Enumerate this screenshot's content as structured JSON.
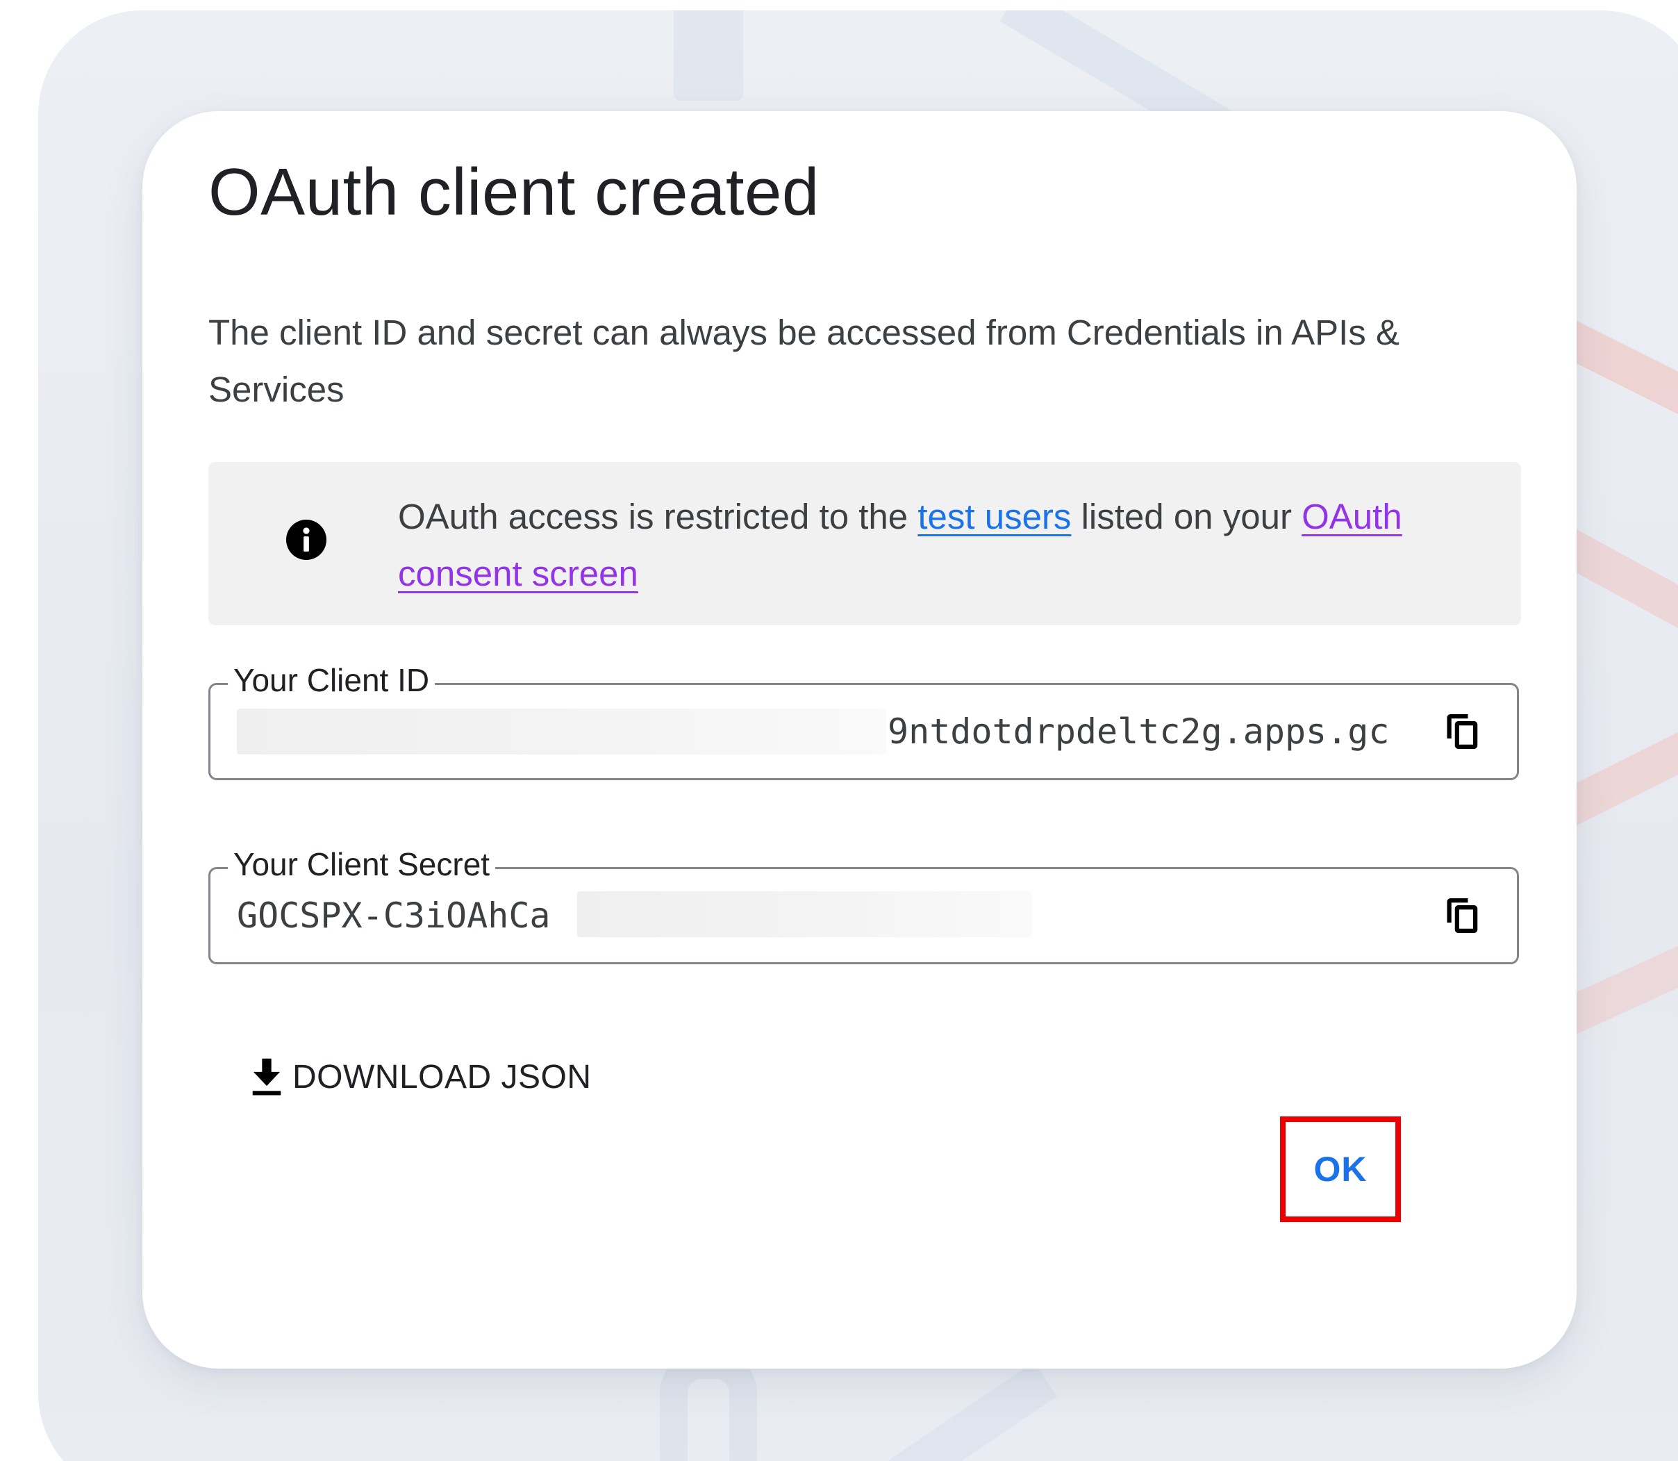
{
  "dialog": {
    "title": "OAuth client created",
    "subtitle": "The client ID and secret can always be accessed from Credentials in APIs & Services",
    "info": {
      "icon": "info-icon",
      "text_before": "OAuth access is restricted to the ",
      "link_test_users": "test users",
      "text_middle": " listed on your ",
      "link_consent": "OAuth consent screen"
    },
    "client_id": {
      "label": "Your Client ID",
      "value": "9ntdotdrpdeltc2g.apps.gc",
      "copy_icon": "copy-icon"
    },
    "client_secret": {
      "label": "Your Client Secret",
      "value": "GOCSPX-C3iOAhCa",
      "copy_icon": "copy-icon"
    },
    "download": {
      "icon": "download-icon",
      "label": "DOWNLOAD JSON"
    },
    "ok_label": "OK"
  },
  "colors": {
    "accent": "#1a73e8",
    "link_visited": "#9334e6",
    "highlight": "#ee0000"
  }
}
